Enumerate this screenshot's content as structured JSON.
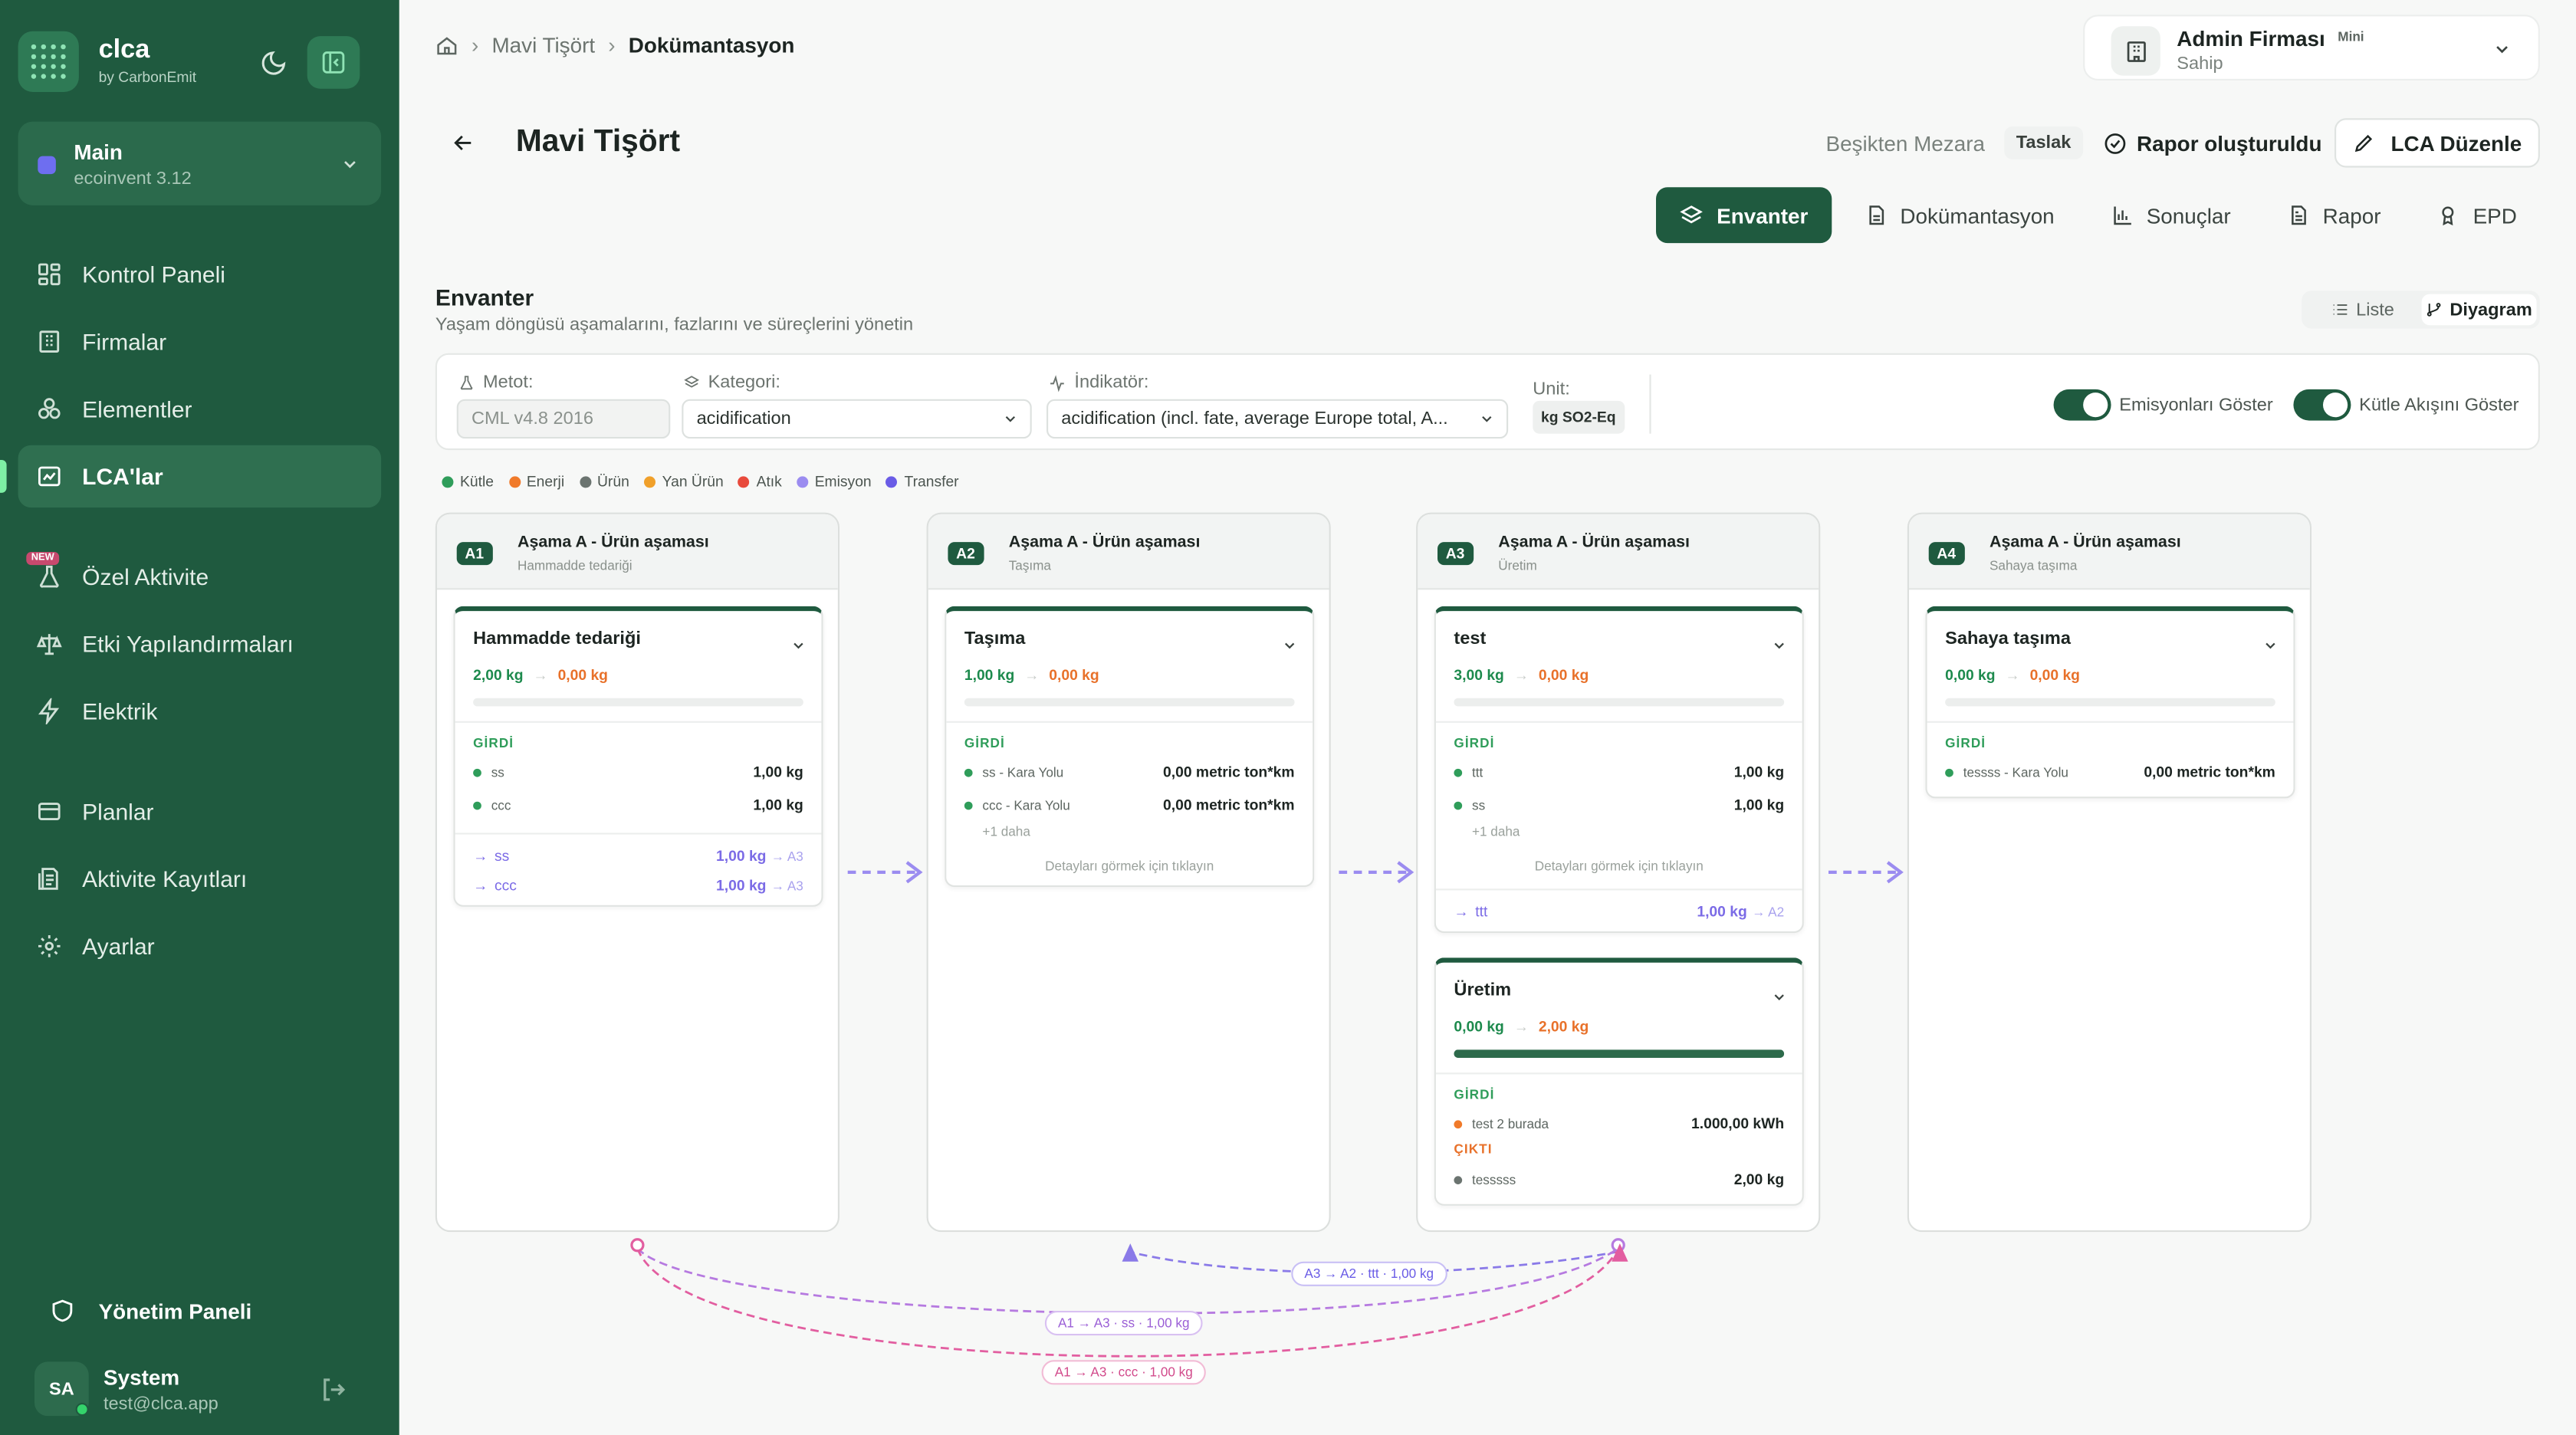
{
  "app": {
    "name": "clca",
    "by": "by CarbonEmit"
  },
  "workspace": {
    "title": "Main",
    "sub": "ecoinvent 3.12"
  },
  "nav": {
    "items": [
      {
        "label": "Kontrol Paneli",
        "icon": "dashboard-icon"
      },
      {
        "label": "Firmalar",
        "icon": "building-icon"
      },
      {
        "label": "Elementler",
        "icon": "elements-icon"
      },
      {
        "label": "LCA'lar",
        "icon": "lca-icon",
        "active": true
      },
      {
        "label": "Özel Aktivite",
        "icon": "flask-icon",
        "badge": "NEW"
      },
      {
        "label": "Etki Yapılandırmaları",
        "icon": "scale-icon"
      },
      {
        "label": "Elektrik",
        "icon": "bolt-icon"
      },
      {
        "label": "Planlar",
        "icon": "plans-icon"
      },
      {
        "label": "Aktivite Kayıtları",
        "icon": "records-icon"
      },
      {
        "label": "Ayarlar",
        "icon": "gear-icon"
      }
    ],
    "admin": "Yönetim Paneli",
    "user": {
      "initials": "SA",
      "name": "System",
      "email": "test@clca.app"
    }
  },
  "breadcrumb": [
    "Mavi Tişört",
    "Dokümantasyon"
  ],
  "firm": {
    "name": "Admin Firması",
    "plan": "Mini",
    "role": "Sahip"
  },
  "page": {
    "title": "Mavi Tişört",
    "scope": "Beşikten Mezara",
    "status": "Taslak",
    "report_status": "Rapor oluşturuldu",
    "edit_label": "LCA Düzenle"
  },
  "tabs": [
    "Envanter",
    "Dokümantasyon",
    "Sonuçlar",
    "Rapor",
    "EPD"
  ],
  "inventory": {
    "title": "Envanter",
    "desc": "Yaşam döngüsü aşamalarını, fazlarını ve süreçlerini yönetin",
    "view_list": "Liste",
    "view_diagram": "Diyagram"
  },
  "filters": {
    "method_label": "Metot:",
    "method": "CML v4.8 2016",
    "category_label": "Kategori:",
    "category": "acidification",
    "indicator_label": "İndikatör:",
    "indicator": "acidification (incl. fate, average Europe total, A...",
    "unit_label": "Unit:",
    "unit": "kg SO2-Eq",
    "toggle_emissions": "Emisyonları Göster",
    "toggle_mass": "Kütle Akışını Göster"
  },
  "legend": [
    {
      "label": "Kütle",
      "color": "#2f9d5a"
    },
    {
      "label": "Enerji",
      "color": "#f07a2a"
    },
    {
      "label": "Ürün",
      "color": "#6b7470"
    },
    {
      "label": "Yan Ürün",
      "color": "#f0a02a"
    },
    {
      "label": "Atık",
      "color": "#e84a3c"
    },
    {
      "label": "Emisyon",
      "color": "#9b8cf0"
    },
    {
      "label": "Transfer",
      "color": "#6a5ce6"
    }
  ],
  "stages": [
    {
      "code": "A1",
      "name": "Aşama A - Ürün aşaması",
      "sub": "Hammadde tedariği",
      "cards": [
        {
          "title": "Hammadde tedariği",
          "in": "2,00 kg",
          "out": "0,00 kg",
          "fill": 0,
          "input_label": "GİRDİ",
          "inputs": [
            {
              "name": "ss",
              "value": "1,00 kg"
            },
            {
              "name": "ccc",
              "value": "1,00 kg"
            }
          ],
          "transfers": [
            {
              "name": "ss",
              "value": "1,00 kg",
              "to": "→ A3"
            },
            {
              "name": "ccc",
              "value": "1,00 kg",
              "to": "→ A3"
            }
          ]
        }
      ]
    },
    {
      "code": "A2",
      "name": "Aşama A - Ürün aşaması",
      "sub": "Taşıma",
      "cards": [
        {
          "title": "Taşıma",
          "in": "1,00 kg",
          "out": "0,00 kg",
          "fill": 0,
          "input_label": "GİRDİ",
          "inputs": [
            {
              "name": "ss - Kara Yolu",
              "value": "0,00 metric ton*km"
            },
            {
              "name": "ccc - Kara Yolu",
              "value": "0,00 metric ton*km"
            }
          ],
          "more": "+1 daha",
          "hint": "Detayları görmek için tıklayın"
        }
      ]
    },
    {
      "code": "A3",
      "name": "Aşama A - Ürün aşaması",
      "sub": "Üretim",
      "cards": [
        {
          "title": "test",
          "in": "3,00 kg",
          "out": "0,00 kg",
          "fill": 0,
          "input_label": "GİRDİ",
          "inputs": [
            {
              "name": "ttt",
              "value": "1,00 kg"
            },
            {
              "name": "ss",
              "value": "1,00 kg"
            }
          ],
          "more": "+1 daha",
          "hint": "Detayları görmek için tıklayın",
          "transfers": [
            {
              "name": "ttt",
              "value": "1,00 kg",
              "to": "→ A2"
            }
          ]
        },
        {
          "title": "Üretim",
          "in": "0,00 kg",
          "out": "2,00 kg",
          "fill": 1,
          "input_label": "GİRDİ",
          "inputs": [
            {
              "name": "test 2 burada",
              "value": "1.000,00 kWh"
            }
          ],
          "output_label": "ÇIKTI",
          "outputs": [
            {
              "name": "tesssss",
              "value": "2,00 kg"
            }
          ]
        }
      ]
    },
    {
      "code": "A4",
      "name": "Aşama A - Ürün aşaması",
      "sub": "Sahaya taşıma",
      "cards": [
        {
          "title": "Sahaya taşıma",
          "in": "0,00 kg",
          "out": "0,00 kg",
          "fill": 0,
          "input_label": "GİRDİ",
          "inputs": [
            {
              "name": "tessss - Kara Yolu",
              "value": "0,00 metric ton*km"
            }
          ]
        }
      ]
    }
  ],
  "transfer_links": [
    "A3 → A2 · ttt · 1,00 kg",
    "A1 → A3 · ss · 1,00 kg",
    "A1 → A3 · ccc · 1,00 kg"
  ]
}
